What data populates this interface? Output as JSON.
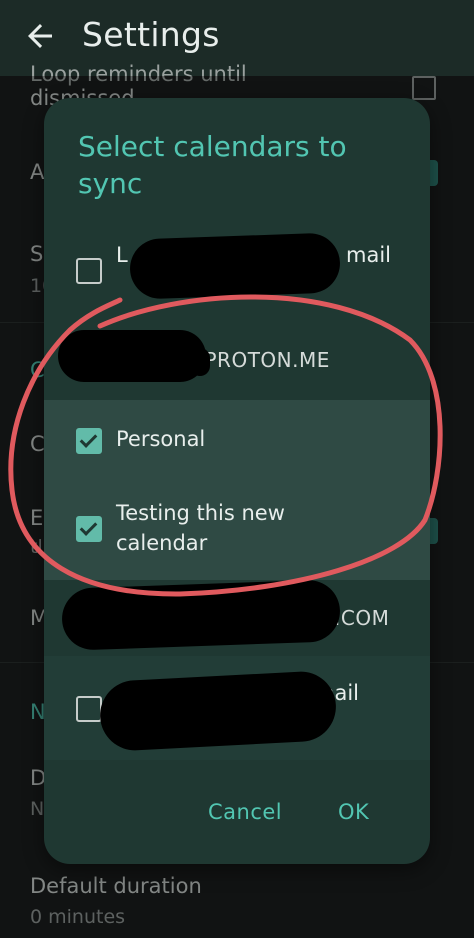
{
  "appbar": {
    "title": "Settings",
    "back_icon": "arrow-left-icon"
  },
  "background": {
    "item_partial_1_line1": "Loop reminders until",
    "item_partial_1_line2": "dismissed",
    "letter_a": "A",
    "letter_s": "S",
    "num_10": "10",
    "letter_c1": "C",
    "letter_c2": "C",
    "letter_e": "E",
    "letter_t": "tl",
    "letter_m": "M",
    "letter_n": "N",
    "letter_d": "D",
    "letter_n2": "N",
    "default_duration_label": "Default duration",
    "default_duration_value": "0 minutes"
  },
  "dialog": {
    "title": "Select calendars to sync",
    "items": [
      {
        "label_prefix": "L",
        "label_suffix": "mail",
        "checked": false
      },
      {
        "account_suffix": "@PROTON.ME"
      },
      {
        "label": "Personal",
        "checked": true
      },
      {
        "label": "Testing this new calendar",
        "checked": true
      },
      {
        "account_suffix": ".COM"
      },
      {
        "label_suffix": "mail",
        "checked": false
      }
    ],
    "cancel_label": "Cancel",
    "ok_label": "OK"
  },
  "colors": {
    "accent": "#52c6b2",
    "dialog_bg": "#1f3832",
    "annotation": "#e05a5e"
  }
}
